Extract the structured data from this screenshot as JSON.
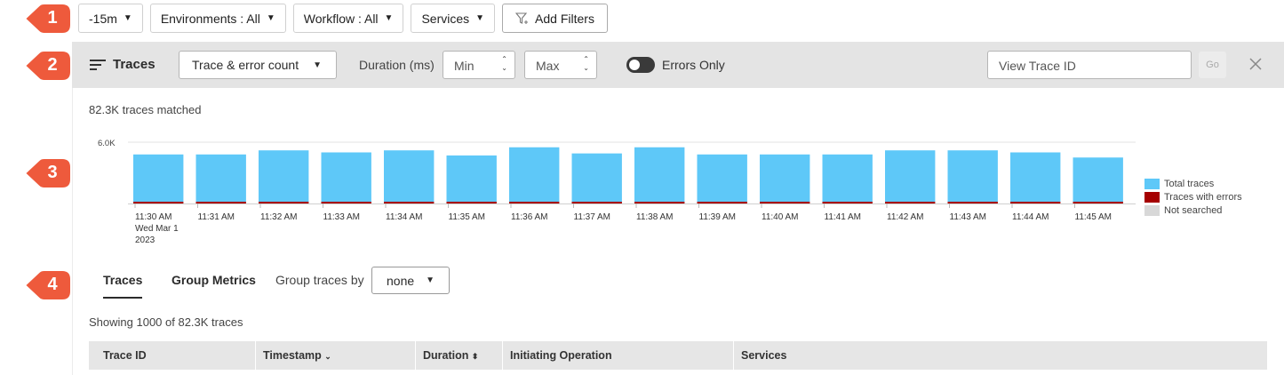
{
  "filters": {
    "time_range": "-15m",
    "environments": "Environments : All",
    "workflow": "Workflow : All",
    "services": "Services",
    "add_filters": "Add Filters"
  },
  "callouts": [
    "1",
    "2",
    "3",
    "4"
  ],
  "toolbar": {
    "title": "Traces",
    "metric_select": "Trace & error count",
    "duration_label": "Duration (ms)",
    "min_placeholder": "Min",
    "max_placeholder": "Max",
    "errors_only_label": "Errors Only",
    "errors_only_on": false,
    "trace_id_placeholder": "View Trace ID",
    "go_label": "Go"
  },
  "summary": {
    "matched": "82.3K traces matched"
  },
  "chart_data": {
    "type": "bar",
    "stacked": true,
    "y_tick_labels": [
      "6.0K"
    ],
    "ylim": [
      0,
      6000
    ],
    "categories": [
      "11:30 AM",
      "11:31 AM",
      "11:32 AM",
      "11:33 AM",
      "11:34 AM",
      "11:35 AM",
      "11:36 AM",
      "11:37 AM",
      "11:38 AM",
      "11:39 AM",
      "11:40 AM",
      "11:41 AM",
      "11:42 AM",
      "11:43 AM",
      "11:44 AM",
      "11:45 AM"
    ],
    "first_tick_sublabel": [
      "Wed Mar 1",
      "2023"
    ],
    "series": [
      {
        "name": "Total traces",
        "color": "#5ec8f8",
        "values": [
          4800,
          4800,
          5200,
          5000,
          5200,
          4700,
          5500,
          4900,
          5500,
          4800,
          4800,
          4800,
          5200,
          5200,
          5000,
          4500
        ]
      },
      {
        "name": "Traces with errors",
        "color": "#a50000",
        "values": [
          120,
          120,
          120,
          120,
          120,
          120,
          120,
          120,
          120,
          120,
          120,
          120,
          120,
          120,
          120,
          120
        ]
      },
      {
        "name": "Not searched",
        "color": "#d8d8d8",
        "values": [
          0,
          0,
          0,
          0,
          0,
          0,
          0,
          0,
          0,
          0,
          0,
          0,
          0,
          0,
          0,
          0
        ]
      }
    ],
    "grid": true,
    "legend": "right"
  },
  "tabs": {
    "items": [
      {
        "label": "Traces",
        "active": true
      },
      {
        "label": "Group Metrics",
        "active": false
      }
    ],
    "group_by_label": "Group traces by",
    "group_by_value": "none"
  },
  "table": {
    "showing": "Showing 1000 of 82.3K traces",
    "columns": [
      "Trace ID",
      "Timestamp",
      "Duration",
      "Initiating Operation",
      "Services"
    ]
  },
  "colors": {
    "accent_callout": "#ee5a3c",
    "band": "#e4e4e4",
    "bar_total": "#5ec8f8",
    "bar_error": "#a50000"
  }
}
